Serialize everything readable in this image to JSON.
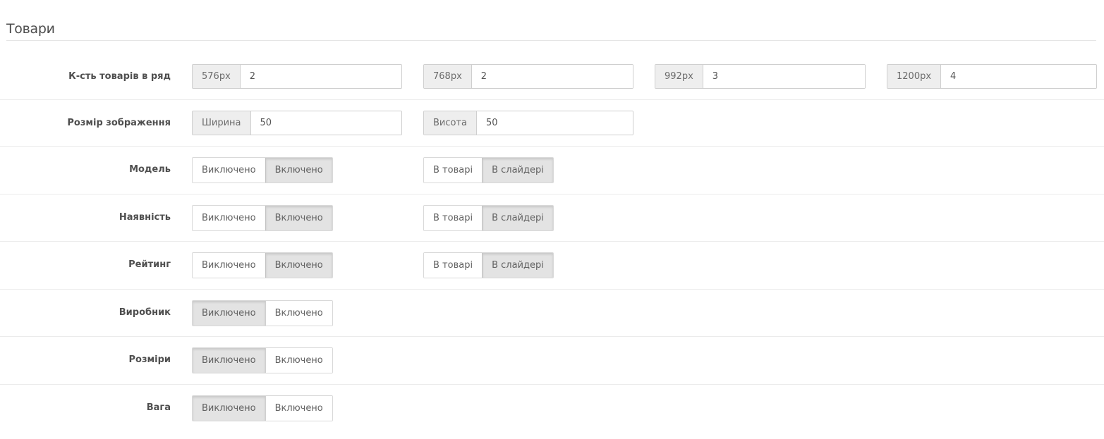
{
  "section": {
    "title": "Товари"
  },
  "rows": {
    "per_row": {
      "label": "К-сть товарів в ряд",
      "fields": [
        {
          "addon": "576px",
          "value": "2"
        },
        {
          "addon": "768px",
          "value": "2"
        },
        {
          "addon": "992px",
          "value": "3"
        },
        {
          "addon": "1200px",
          "value": "4"
        }
      ]
    },
    "image_size": {
      "label": "Розмір зображення",
      "fields": [
        {
          "addon": "Ширина",
          "value": "50"
        },
        {
          "addon": "Висота",
          "value": "50"
        }
      ]
    },
    "model": {
      "label": "Модель",
      "toggle": {
        "off": "Виключено",
        "on": "Включено",
        "active": "on"
      },
      "place": {
        "product": "В товарі",
        "slider": "В слайдері",
        "active": "slider"
      }
    },
    "availability": {
      "label": "Наявність",
      "toggle": {
        "off": "Виключено",
        "on": "Включено",
        "active": "on"
      },
      "place": {
        "product": "В товарі",
        "slider": "В слайдері",
        "active": "slider"
      }
    },
    "rating": {
      "label": "Рейтинг",
      "toggle": {
        "off": "Виключено",
        "on": "Включено",
        "active": "on"
      },
      "place": {
        "product": "В товарі",
        "slider": "В слайдері",
        "active": "slider"
      }
    },
    "manufacturer": {
      "label": "Виробник",
      "toggle": {
        "off": "Виключено",
        "on": "Включено",
        "active": "off"
      }
    },
    "dimensions": {
      "label": "Розміри",
      "toggle": {
        "off": "Виключено",
        "on": "Включено",
        "active": "off"
      }
    },
    "weight": {
      "label": "Вага",
      "toggle": {
        "off": "Виключено",
        "on": "Включено",
        "active": "off"
      }
    }
  }
}
